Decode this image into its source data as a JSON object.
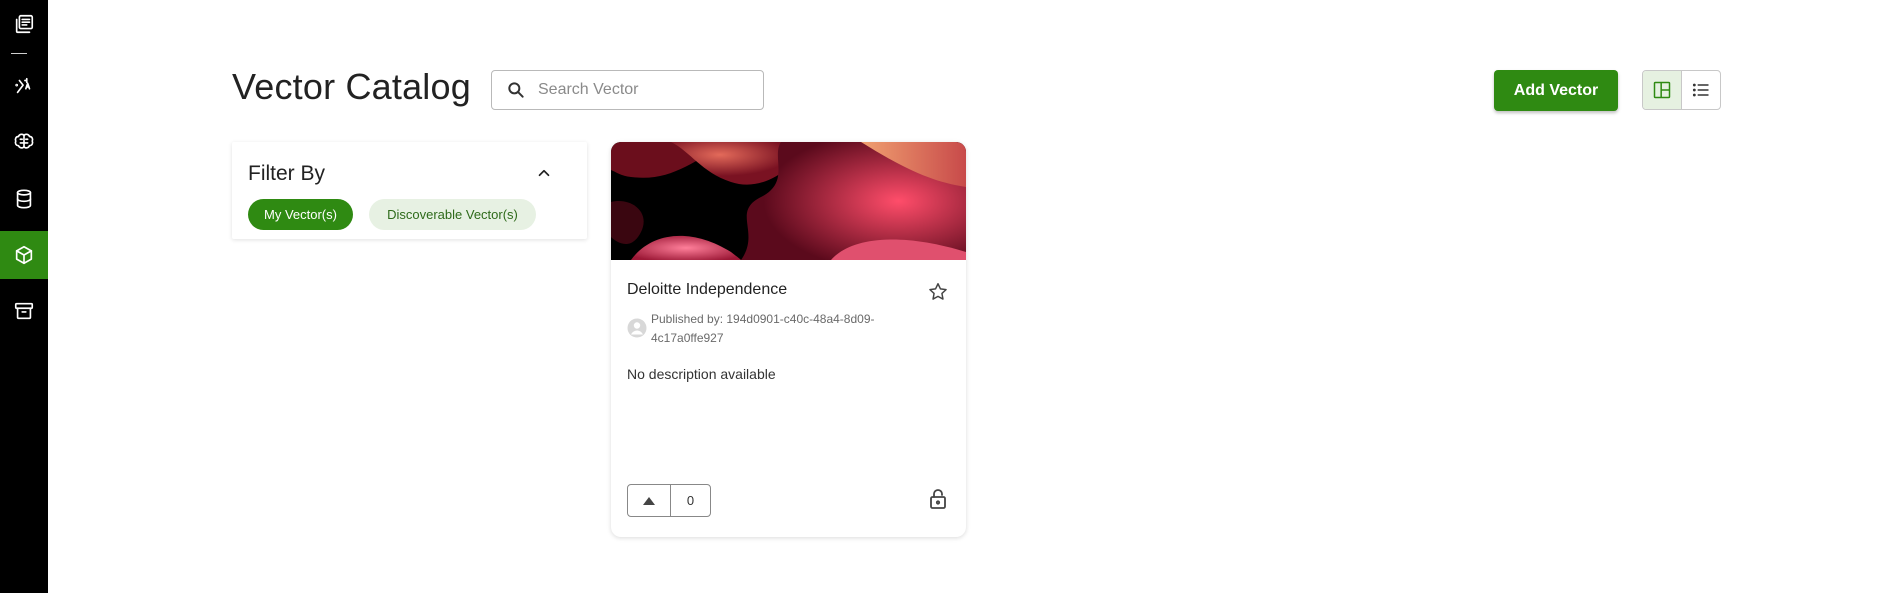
{
  "sidebar": {
    "items": [
      {
        "icon": "library-icon",
        "active": false
      },
      {
        "icon": "prompt-icon",
        "active": false
      },
      {
        "icon": "brain-icon",
        "active": false
      },
      {
        "icon": "database-icon",
        "active": false
      },
      {
        "icon": "cube-icon",
        "active": true
      },
      {
        "icon": "archive-icon",
        "active": false
      }
    ]
  },
  "header": {
    "title": "Vector Catalog",
    "search_placeholder": "Search Vector",
    "add_button_label": "Add Vector",
    "view_modes": [
      "grid",
      "list"
    ],
    "active_view": "grid"
  },
  "filter": {
    "title": "Filter By",
    "chips": [
      {
        "label": "My Vector(s)",
        "active": true
      },
      {
        "label": "Discoverable Vector(s)",
        "active": false
      }
    ]
  },
  "cards": [
    {
      "title": "Deloitte Independence",
      "published_by": "Published by: 194d0901-c40c-48a4-8d09-4c17a0ffe927",
      "description": "No description available",
      "votes": "0",
      "favorited": false,
      "locked": true
    }
  ],
  "colors": {
    "accent": "#2f8a12",
    "sidebar_bg": "#000000",
    "chip_inactive_bg": "#e7f1e3"
  }
}
